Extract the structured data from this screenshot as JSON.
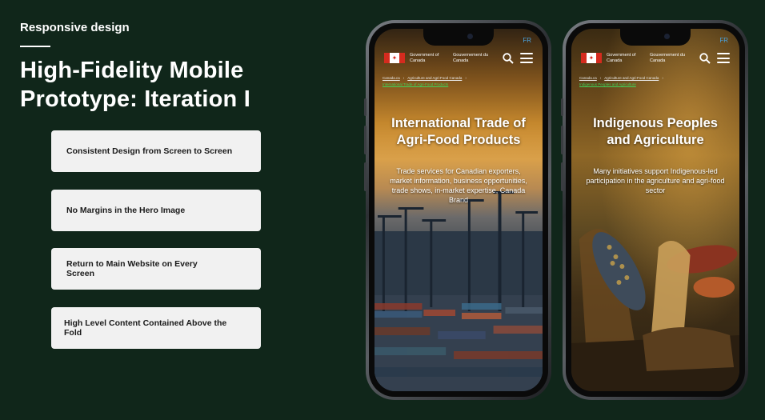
{
  "header": {
    "eyebrow": "Responsive design",
    "headline_line1": "High-Fidelity Mobile",
    "headline_line2": "Prototype: Iteration I"
  },
  "cards": [
    {
      "label": "Consistent Design from Screen to Screen"
    },
    {
      "label": "No Margins in the Hero Image"
    },
    {
      "label": "Return to Main Website on Every Screen"
    },
    {
      "label": "High Level Content Contained Above the Fold"
    }
  ],
  "phones": [
    {
      "lang_toggle": "FR",
      "gov_en": "Government of Canada",
      "gov_fr": "Gouvernement du Canada",
      "crumbs": [
        "Canada.ca",
        "Agriculture and Agri-Food Canada"
      ],
      "crumb_current": "International Trade of Agri-Food Products",
      "title_line1": "International Trade of",
      "title_line2": "Agri-Food Products",
      "subtitle": "Trade services for Canadian exporters, market information, business opportunities, trade shows, in-market expertise, Canada Brand"
    },
    {
      "lang_toggle": "FR",
      "gov_en": "Government of Canada",
      "gov_fr": "Gouvernement du Canada",
      "crumbs": [
        "Canada.ca",
        "Agriculture and Agri-Food Canada"
      ],
      "crumb_current": "Indigenous Peoples and Agriculture",
      "title_line1": "Indigenous Peoples",
      "title_line2": "and Agriculture",
      "subtitle": "Many initiatives support Indigenous-led participation in the agriculture and agri-food sector"
    }
  ],
  "colors": {
    "background": "#10261a",
    "card": "#f1f1f1",
    "crumb_current": "#3fd65a",
    "fr_link": "#4aa3df",
    "flag_red": "#d52b1e"
  }
}
